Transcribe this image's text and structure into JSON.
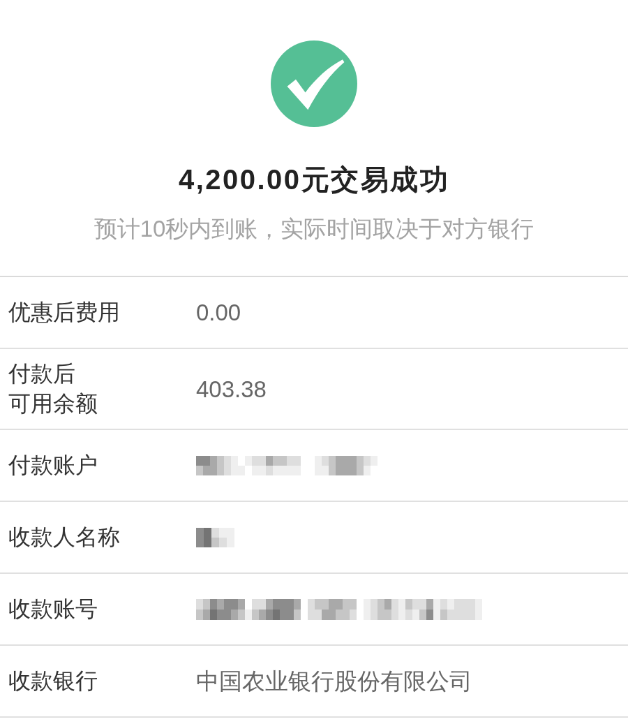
{
  "title": "4,200.00元交易成功",
  "subtitle": "预计10秒内到账，实际时间取决于对方银行",
  "details": [
    {
      "label_lines": [
        "优惠后费用"
      ],
      "kind": "text",
      "value": "0.00"
    },
    {
      "label_lines": [
        "付款后",
        "可用余额"
      ],
      "kind": "text",
      "value": "403.38"
    },
    {
      "label_lines": [
        "付款账户"
      ],
      "kind": "masked_card_number"
    },
    {
      "label_lines": [
        "收款人名称"
      ],
      "kind": "masked_name"
    },
    {
      "label_lines": [
        "收款账号"
      ],
      "kind": "masked_account_number"
    },
    {
      "label_lines": [
        "收款银行"
      ],
      "kind": "text",
      "value": "中国农业银行股份有限公司"
    }
  ]
}
